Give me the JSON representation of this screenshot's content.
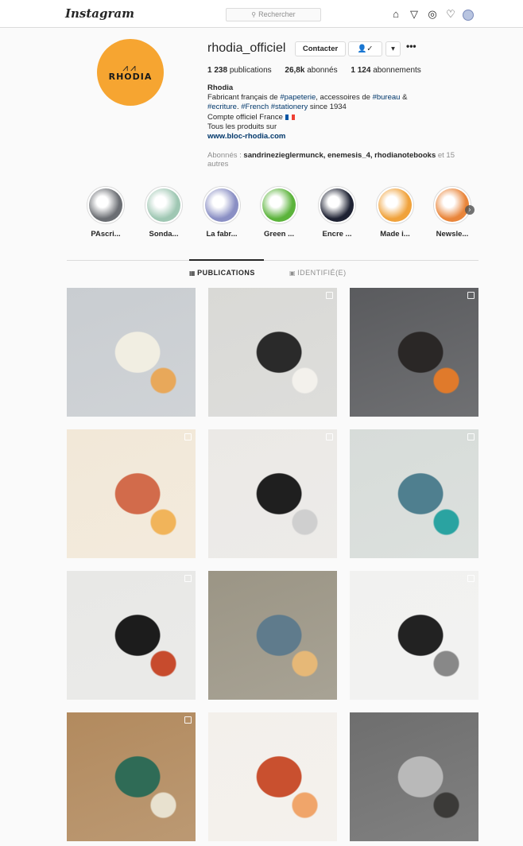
{
  "topbar": {
    "logo": "Instagram",
    "search_placeholder": "Rechercher",
    "icons": [
      "home-icon",
      "direct-icon",
      "explore-icon",
      "heart-icon",
      "avatar"
    ]
  },
  "profile": {
    "username": "rhodia_officiel",
    "contact_label": "Contacter",
    "follow_label": "👤✓",
    "dropdown_label": "▾",
    "more_label": "•••",
    "logo_text": "RHODIA",
    "stats": {
      "publications_count": "1 238",
      "publications_label": "publications",
      "followers_count": "26,8k",
      "followers_label": "abonnés",
      "following_count": "1 124",
      "following_label": "abonnements"
    },
    "bio": {
      "name": "Rhodia",
      "line1_a": "Fabricant français de ",
      "line1_tag1": "#papeterie",
      "line1_b": ", accessoires de ",
      "line1_tag2": "#bureau",
      "line1_c": " &",
      "line2_tag1": "#ecriture",
      "line2_a": ". ",
      "line2_tag2": "#French",
      "line2_b": " ",
      "line2_tag3": "#stationery",
      "line2_c": " since 1934",
      "line3": "Compte officiel France",
      "line4": "Tous les produits sur",
      "link": "www.bloc-rhodia.com"
    },
    "followed_by": {
      "prefix": "Abonnés : ",
      "names": "sandrinezieglermunck, enemesis_4, rhodianotebooks",
      "suffix": " et 15 autres"
    }
  },
  "highlights": [
    {
      "label": "PAscri...",
      "color": "#6b6e73"
    },
    {
      "label": "Sonda...",
      "color": "#9fc7b3"
    },
    {
      "label": "La fabr...",
      "color": "#8a8fc4"
    },
    {
      "label": "Green ...",
      "color": "#5bb33b"
    },
    {
      "label": "Encre ...",
      "color": "#1e2233"
    },
    {
      "label": "Made i...",
      "color": "#f0a23b"
    },
    {
      "label": "Newsle...",
      "color": "#e9853a"
    }
  ],
  "tabs": {
    "publications": "PUBLICATIONS",
    "tagged": "IDENTIFIÉ(E)"
  },
  "posts": [
    {
      "name": "post-girl-drawing",
      "colors": [
        "#c9cdd1",
        "#f1eee2",
        "#e8a85a"
      ]
    },
    {
      "name": "post-sketchbook-coffee",
      "colors": [
        "#d9d9d6",
        "#2a2a2a",
        "#f3f1ec"
      ]
    },
    {
      "name": "post-pug-notebook",
      "colors": [
        "#5a5b5e",
        "#2a2726",
        "#e07a2b"
      ]
    },
    {
      "name": "post-advent-box",
      "colors": [
        "#f2e8d8",
        "#d26b4b",
        "#f1b45a"
      ]
    },
    {
      "name": "post-leather-roll",
      "colors": [
        "#ebe9e6",
        "#1f1f1f",
        "#cfcfcf"
      ]
    },
    {
      "name": "post-painting-markers",
      "colors": [
        "#d7dcd9",
        "#4f7f8f",
        "#2aa3a1"
      ]
    },
    {
      "name": "post-desk-bag",
      "colors": [
        "#e8e8e6",
        "#1c1c1c",
        "#c74b2d"
      ]
    },
    {
      "name": "post-pencil-cup",
      "colors": [
        "#9b9585",
        "#5f7b8c",
        "#e6b877"
      ]
    },
    {
      "name": "post-black-notebook",
      "colors": [
        "#f1f1f0",
        "#222",
        "#888"
      ]
    },
    {
      "name": "post-open-notebook-plant",
      "colors": [
        "#b28a5e",
        "#2f6b56",
        "#e8e1cf"
      ]
    },
    {
      "name": "post-flowers-vase",
      "colors": [
        "#f3f0eb",
        "#c9502f",
        "#f0a56a"
      ]
    },
    {
      "name": "post-grey-papers",
      "colors": [
        "#6e6e6e",
        "#b9b9b9",
        "#3b3a38"
      ]
    }
  ]
}
